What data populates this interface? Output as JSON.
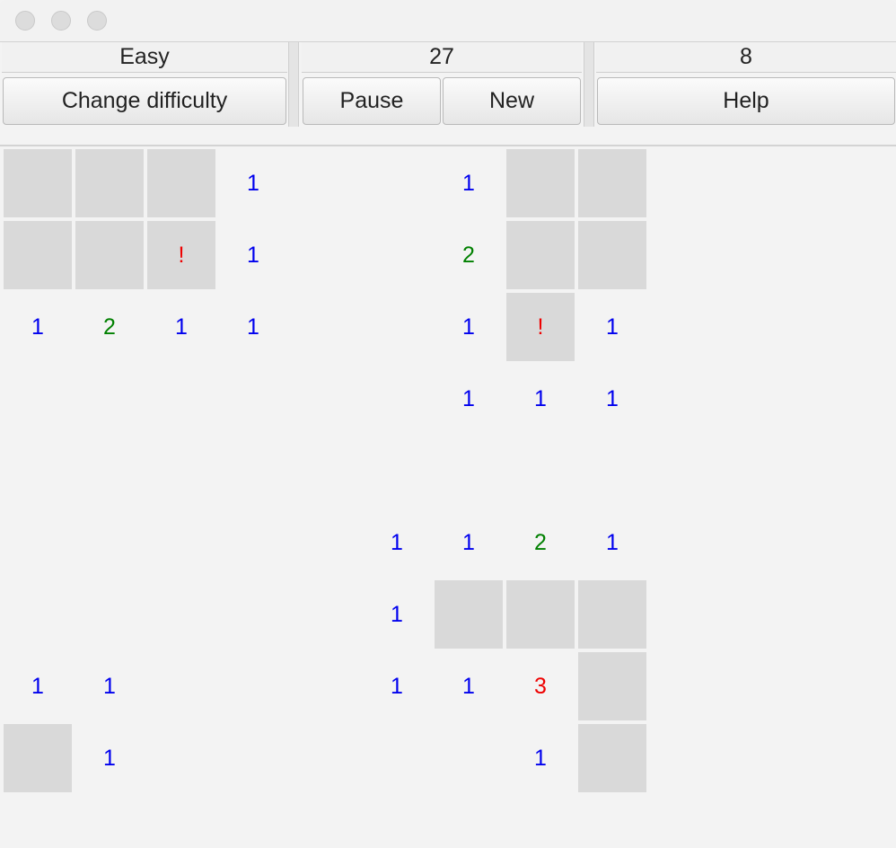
{
  "window": {
    "controls": [
      "close-button",
      "minimize-button",
      "zoom-button"
    ]
  },
  "status": {
    "difficulty": "Easy",
    "timer": "27",
    "mines_left": "8"
  },
  "toolbar": {
    "change_difficulty_label": "Change difficulty",
    "pause_label": "Pause",
    "new_label": "New",
    "help_label": "Help"
  },
  "colors": {
    "covered": "#d9d9d9",
    "one": "#0000ee",
    "two": "#008000",
    "three": "#ee0000",
    "flag": "#ee0000"
  },
  "board": {
    "rows": 9,
    "cols": 9,
    "grid": [
      [
        "C",
        "C",
        "C",
        "1",
        "",
        "",
        "1",
        "C",
        "C"
      ],
      [
        "C",
        "C",
        "!",
        "1",
        "",
        "",
        "2",
        "C",
        "C"
      ],
      [
        "1",
        "2",
        "1",
        "1",
        "",
        "",
        "1",
        "!",
        "1"
      ],
      [
        "",
        "",
        "",
        "",
        "",
        "",
        "1",
        "1",
        "1"
      ],
      [
        "",
        "",
        "",
        "",
        "",
        "",
        "",
        "",
        ""
      ],
      [
        "",
        "",
        "",
        "",
        "",
        "1",
        "1",
        "2",
        "1"
      ],
      [
        "",
        "",
        "",
        "",
        "",
        "1",
        "C",
        "C",
        "C"
      ],
      [
        "1",
        "1",
        "",
        "",
        "",
        "1",
        "1",
        "3",
        "C"
      ],
      [
        "C",
        "1",
        "",
        "",
        "",
        "",
        "",
        "1",
        "C"
      ]
    ]
  }
}
